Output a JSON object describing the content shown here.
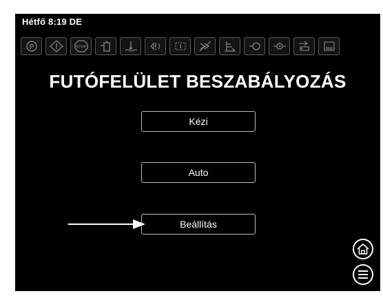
{
  "status": {
    "datetime": "Hétfő 8:19 DE"
  },
  "warning_icons": [
    "parking-brake-icon",
    "warning-triangle-icon",
    "stop-icon",
    "fuel-filter-icon",
    "coolant-temp-icon",
    "oil-pressure-icon",
    "transmission-icon",
    "engine-warning-icon",
    "hydraulic-level-icon",
    "glow-plug-icon",
    "air-filter-icon",
    "battery-icon",
    "water-in-fuel-icon"
  ],
  "page": {
    "title": "FUTÓFELÜLET BESZABÁLYOZÁS"
  },
  "menu": {
    "manual_label": "Kézi",
    "auto_label": "Auto",
    "settings_label": "Beállítás"
  },
  "nav": {
    "home_icon": "home-icon",
    "menu_icon": "menu-icon"
  },
  "colors": {
    "background": "#000000",
    "text": "#ffffff",
    "button_border": "#bbbbbb"
  }
}
